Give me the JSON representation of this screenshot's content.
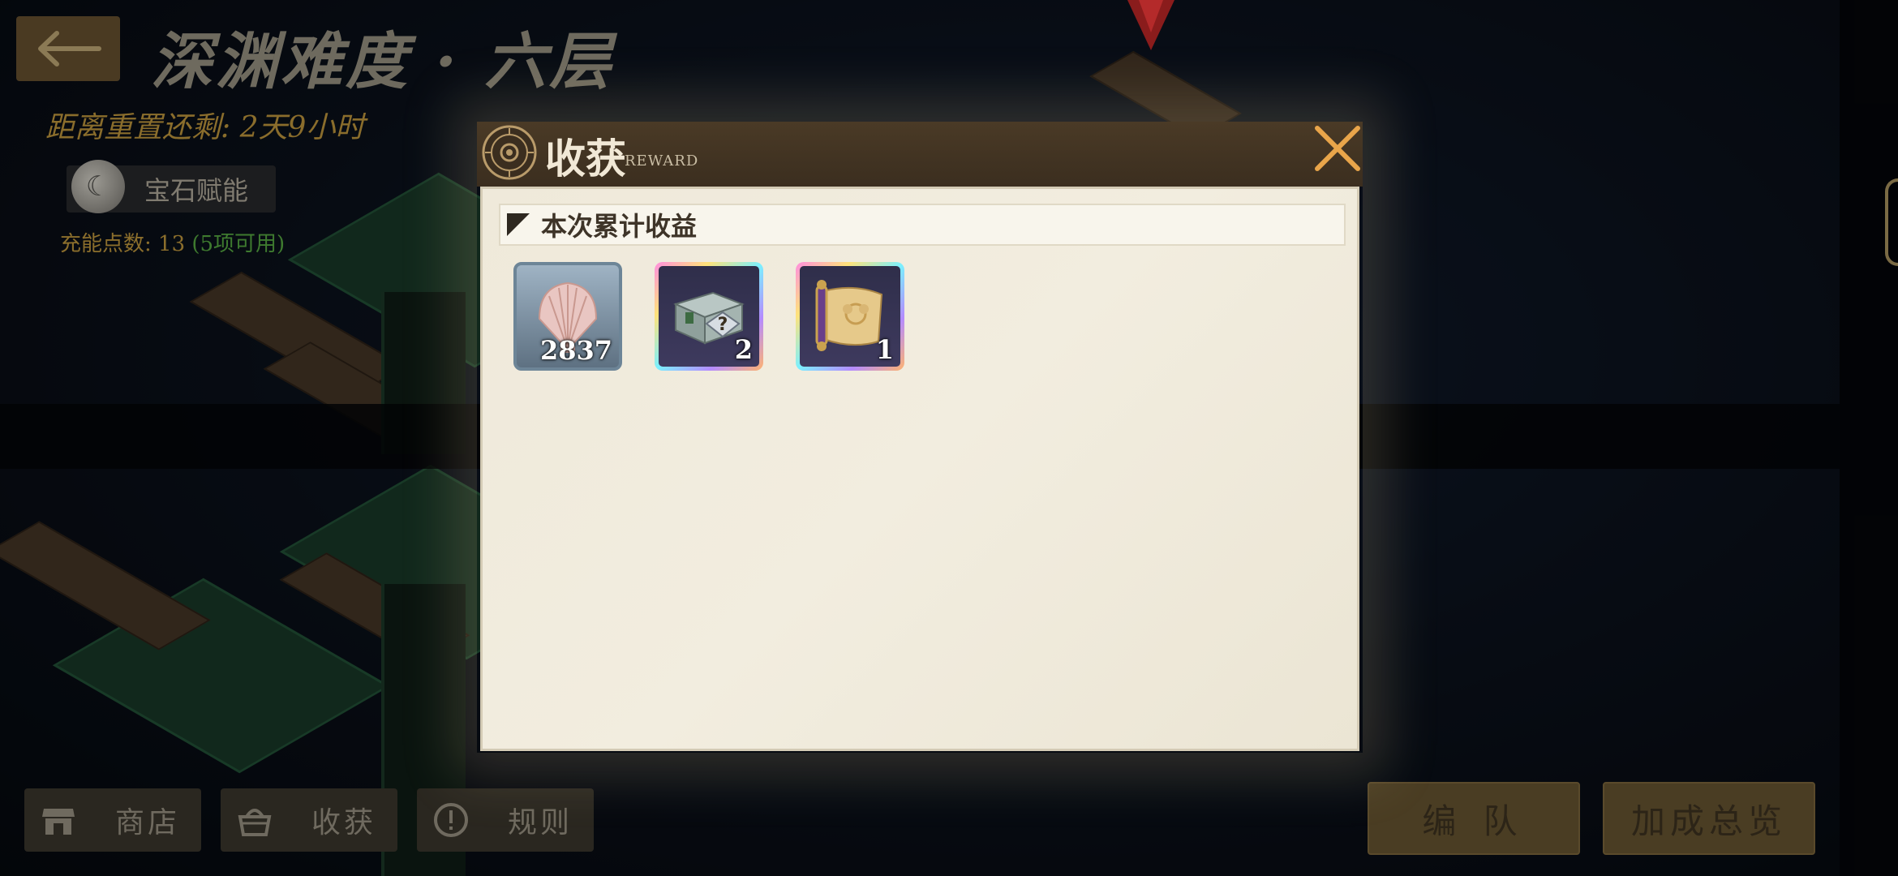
{
  "header": {
    "stage_title": "深渊难度 · 六层",
    "reset_text": "距离重置还剩: 2天9小时"
  },
  "gem": {
    "label": "宝石赋能",
    "charge_prefix": "充能点数: 13",
    "charge_available": "(5项可用)"
  },
  "bottom_nav": {
    "shop": "商店",
    "harvest": "收获",
    "rules": "规则",
    "team": "编 队",
    "bonus": "加成总览"
  },
  "modal": {
    "title": "收获",
    "subtitle": "REWARD",
    "section_title": "本次累计收益",
    "items": [
      {
        "icon": "shell-icon",
        "count": "2837"
      },
      {
        "icon": "mystery-chest-icon",
        "count": "2"
      },
      {
        "icon": "golden-scroll-icon",
        "count": "1"
      }
    ]
  },
  "colors": {
    "accent_gold": "#e9a54a",
    "panel_bg": "#efe9da",
    "header_brown": "#3b2e1f"
  }
}
